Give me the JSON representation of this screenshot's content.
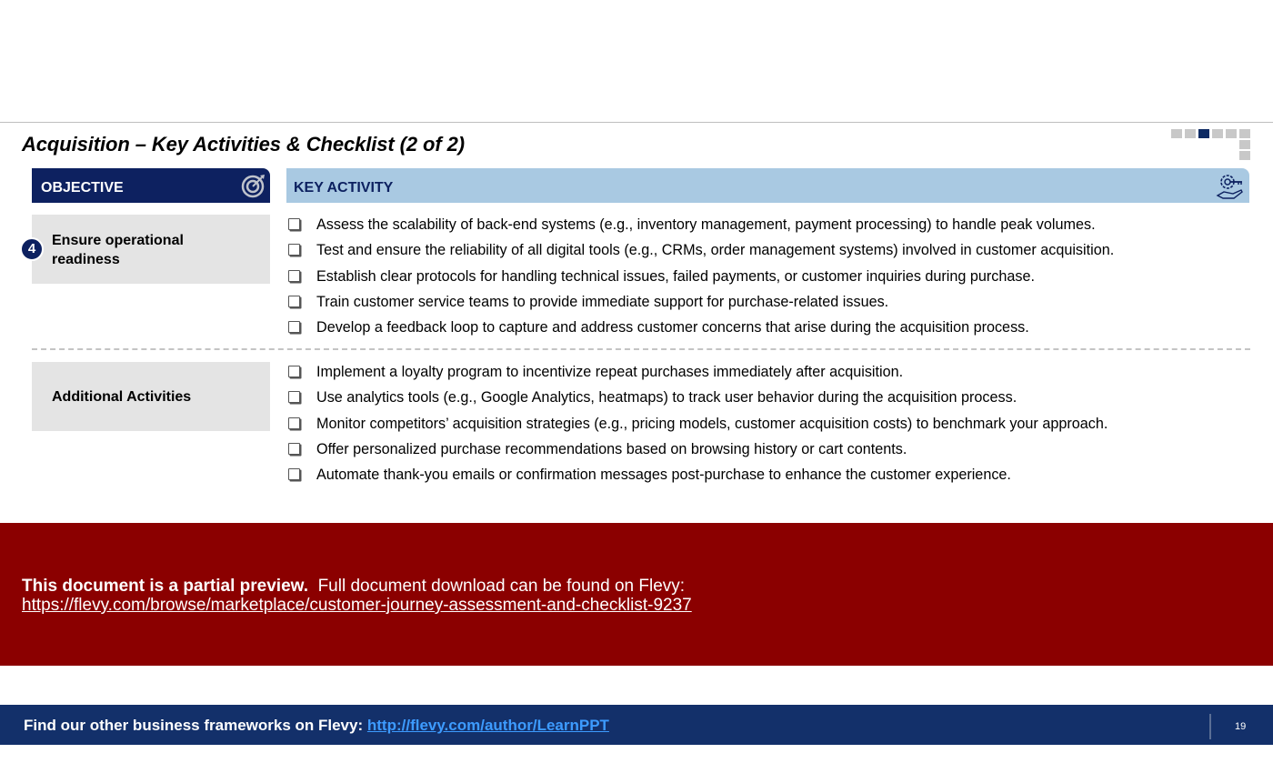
{
  "slide": {
    "title": "Acquisition – Key Activities & Checklist (2 of 2)",
    "nav_indicator": {
      "total_horizontal": 6,
      "active_index": 2,
      "total_vertical": 3
    }
  },
  "headers": {
    "objective": {
      "label": "OBJECTIVE",
      "icon": "target-icon"
    },
    "key_activity": {
      "label": "KEY ACTIVITY",
      "icon": "hand-gear-key-icon"
    }
  },
  "sections": [
    {
      "number": "4",
      "objective": "Ensure operational readiness",
      "activities": [
        "Assess the scalability of back-end systems (e.g., inventory management, payment processing) to handle peak volumes.",
        "Test and ensure the reliability of all digital tools (e.g., CRMs, order management systems) involved in customer acquisition.",
        "Establish clear protocols for handling technical issues, failed payments, or customer inquiries during purchase.",
        "Train customer service teams to provide immediate support for purchase-related issues.",
        "Develop a feedback loop to capture and address customer concerns that arise during the acquisition process."
      ]
    },
    {
      "objective": "Additional Activities",
      "activities": [
        "Implement a loyalty program to incentivize repeat purchases immediately after acquisition.",
        "Use analytics tools (e.g., Google Analytics, heatmaps) to track user behavior during the acquisition process.",
        "Monitor competitors’ acquisition strategies (e.g., pricing models, customer acquisition costs) to benchmark your approach.",
        "Offer personalized purchase recommendations based on browsing history or cart contents.",
        "Automate thank-you emails or confirmation messages post-purchase to enhance the customer experience."
      ]
    }
  ],
  "preview_banner": {
    "bold_text": "This document is a partial preview.",
    "text": "Full document download can be found on Flevy:",
    "link": "https://flevy.com/browse/marketplace/customer-journey-assessment-and-checklist-9237"
  },
  "footer": {
    "text": "Find our other business frameworks on Flevy:",
    "link": "http://flevy.com/author/LearnPPT",
    "page_number": "19"
  },
  "colors": {
    "navy": "#0d2160",
    "light_blue": "#a9c9e2",
    "banner_red": "#8b0000",
    "footer_blue": "#13306a",
    "link_blue": "#3d9bff"
  }
}
